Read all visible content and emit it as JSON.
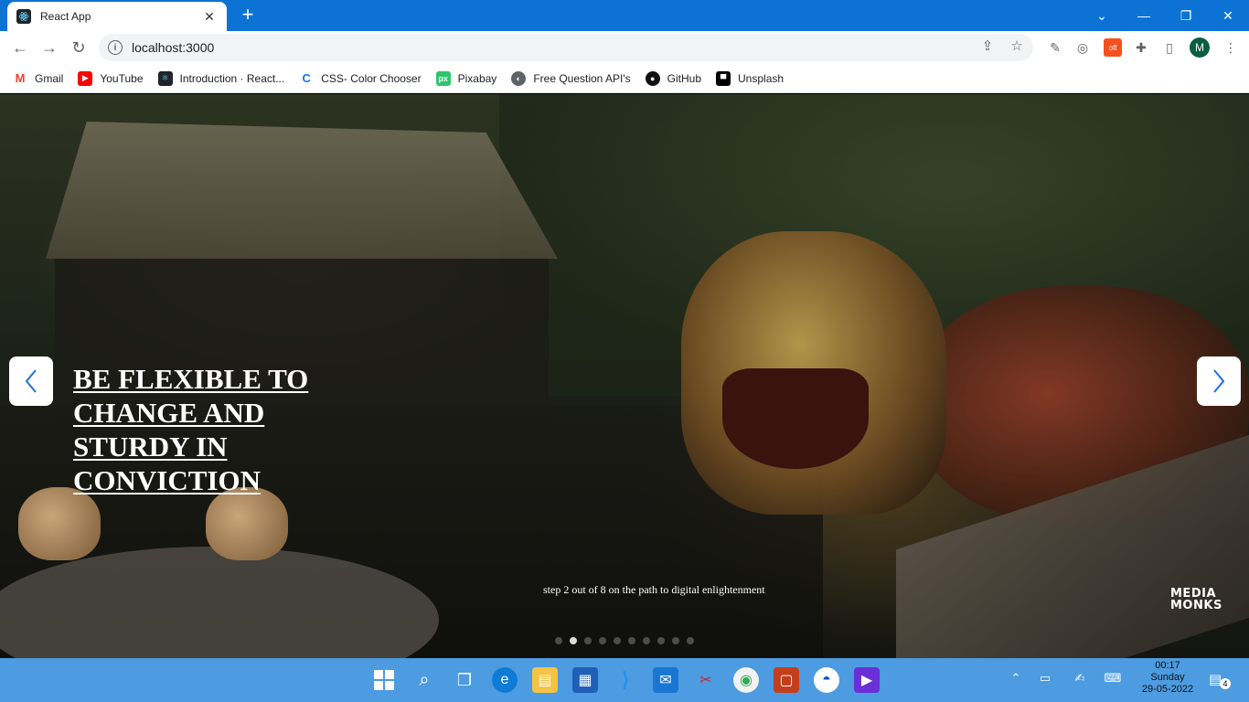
{
  "browser": {
    "tab_title": "React App",
    "tab_close": "✕",
    "new_tab": "+",
    "url": "localhost:3000",
    "profile_initial": "M",
    "ext_badge": "off"
  },
  "bookmarks": [
    {
      "label": "Gmail",
      "icon": "gmail-icon",
      "color": "#ea4335"
    },
    {
      "label": "YouTube",
      "icon": "youtube-icon",
      "color": "#ff0000"
    },
    {
      "label": "Introduction · React...",
      "icon": "react-icon",
      "color": "#20232a"
    },
    {
      "label": "CSS- Color Chooser",
      "icon": "color-chooser-icon",
      "color": "#1a73e8"
    },
    {
      "label": "Pixabay",
      "icon": "pixabay-icon",
      "color": "#2ec66d"
    },
    {
      "label": "Free Question API's",
      "icon": "globe-icon",
      "color": "#5f6368"
    },
    {
      "label": "GitHub",
      "icon": "github-icon",
      "color": "#111111"
    },
    {
      "label": "Unsplash",
      "icon": "unsplash-icon",
      "color": "#000000"
    }
  ],
  "hero": {
    "headline": "BE FLEXIBLE TO CHANGE AND STURDY IN CONVICTION",
    "step_text": "step 2 out of 8 on the path to digital enlightenment",
    "logo_line1": "MEDIA",
    "logo_line2": "MONKS",
    "slide_count": 10,
    "active_slide": 2
  },
  "taskbar": {
    "time": "00:17",
    "day": "Sunday",
    "date": "29-05-2022",
    "notification_count": "4"
  }
}
